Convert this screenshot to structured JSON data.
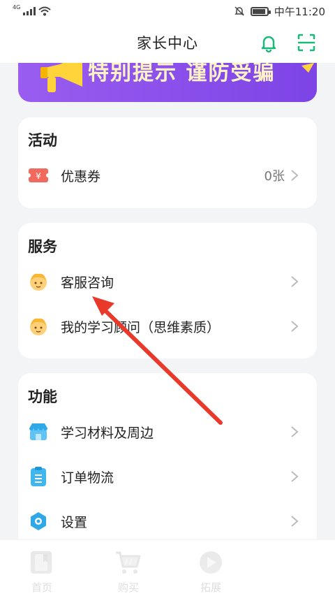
{
  "status_bar": {
    "network": "4G",
    "time": "中午11:20"
  },
  "header": {
    "title": "家长中心"
  },
  "banner": {
    "text": "特别提示 谨防受骗"
  },
  "activity": {
    "title": "活动",
    "items": [
      {
        "label": "优惠券",
        "value": "0张",
        "icon": "coupon-icon"
      }
    ]
  },
  "service": {
    "title": "服务",
    "items": [
      {
        "label": "客服咨询",
        "icon": "advisor-avatar-icon"
      },
      {
        "label": "我的学习顾问（思维素质）",
        "icon": "advisor-avatar-icon"
      }
    ]
  },
  "functions": {
    "title": "功能",
    "items": [
      {
        "label": "学习材料及周边",
        "icon": "shop-icon"
      },
      {
        "label": "订单物流",
        "icon": "order-icon"
      },
      {
        "label": "设置",
        "icon": "settings-icon"
      }
    ]
  },
  "tabbar": {
    "tabs": [
      {
        "label": "首页",
        "icon": "home-book-icon"
      },
      {
        "label": "购买",
        "icon": "cart-icon"
      },
      {
        "label": "拓展",
        "icon": "play-icon"
      }
    ]
  },
  "colors": {
    "accent": "#19b97a",
    "banner": "#8b52ec",
    "annotation_arrow": "#e8392a"
  }
}
